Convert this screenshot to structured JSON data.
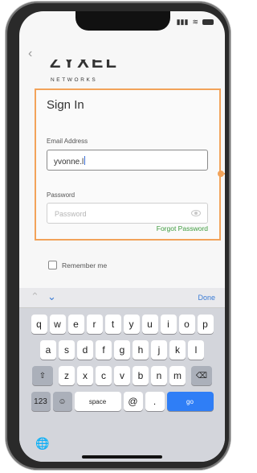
{
  "status_icons": [
    "signal-icon",
    "wifi-icon",
    "battery-icon"
  ],
  "header": {
    "back_icon": "‹"
  },
  "logo": {
    "brand": "ZYXEL",
    "tagline": "NETWORKS"
  },
  "signin": {
    "title": "Sign In",
    "email_label": "Email Address",
    "email_value": "yvonne.l",
    "password_label": "Password",
    "password_placeholder": "Password",
    "forgot_label": "Forgot Password"
  },
  "remember_label": "Remember me",
  "keyboard": {
    "accessory": {
      "up": "⌃",
      "down": "⌄",
      "done": "Done"
    },
    "row1": [
      "q",
      "w",
      "e",
      "r",
      "t",
      "y",
      "u",
      "i",
      "o",
      "p"
    ],
    "row2": [
      "a",
      "s",
      "d",
      "f",
      "g",
      "h",
      "j",
      "k",
      "l"
    ],
    "row3": [
      "z",
      "x",
      "c",
      "v",
      "b",
      "n",
      "m"
    ],
    "shift": "⇧",
    "backspace": "⌫",
    "numbers": "123",
    "emoji": "☺",
    "space": "space",
    "at": "@",
    "dot": ".",
    "go": "go",
    "globe": "🌐"
  },
  "colors": {
    "highlight": "#f2a35a",
    "link_green": "#3f9b3f",
    "keyboard_blue": "#2f7ef6"
  }
}
